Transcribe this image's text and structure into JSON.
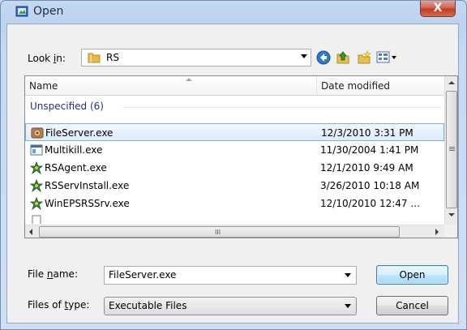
{
  "dialog": {
    "title": "Open",
    "close_glyph": "X"
  },
  "lookin": {
    "label_pre": "Look ",
    "label_accel": "i",
    "label_post": "n:",
    "folder": "RS"
  },
  "toolbar": {
    "icons": [
      "back-icon",
      "up-folder-icon",
      "new-folder-icon",
      "view-menu-icon"
    ]
  },
  "list": {
    "columns": {
      "name": "Name",
      "date": "Date modified"
    },
    "group": "Unspecified (6)",
    "rows": [
      {
        "name": "FileServer.exe",
        "date": "12/3/2010 3:31 PM",
        "selected": true,
        "icon": "fileserver-app-icon"
      },
      {
        "name": "Multikill.exe",
        "date": "11/30/2004 1:41 PM",
        "selected": false,
        "icon": "window-app-icon"
      },
      {
        "name": "RSAgent.exe",
        "date": "12/1/2010 9:49 AM",
        "selected": false,
        "icon": "rs-app-icon"
      },
      {
        "name": "RSServInstall.exe",
        "date": "3/26/2010 10:18 AM",
        "selected": false,
        "icon": "rs-app-icon"
      },
      {
        "name": "WinEPSRSSrv.exe",
        "date": "12/10/2010 12:47 ...",
        "selected": false,
        "icon": "rs-app-icon"
      }
    ],
    "hscroll_grip": "III"
  },
  "filename": {
    "label_pre": "File ",
    "label_accel": "n",
    "label_post": "ame:",
    "value": "FileServer.exe"
  },
  "filetype": {
    "label_pre": "Files of ",
    "label_accel": "t",
    "label_post": "ype:",
    "value": "Executable Files"
  },
  "buttons": {
    "open": "Open",
    "cancel": "Cancel"
  },
  "colors": {
    "selection": "#dcebfc",
    "group_text": "#1e3287",
    "close": "#c43c1f"
  }
}
